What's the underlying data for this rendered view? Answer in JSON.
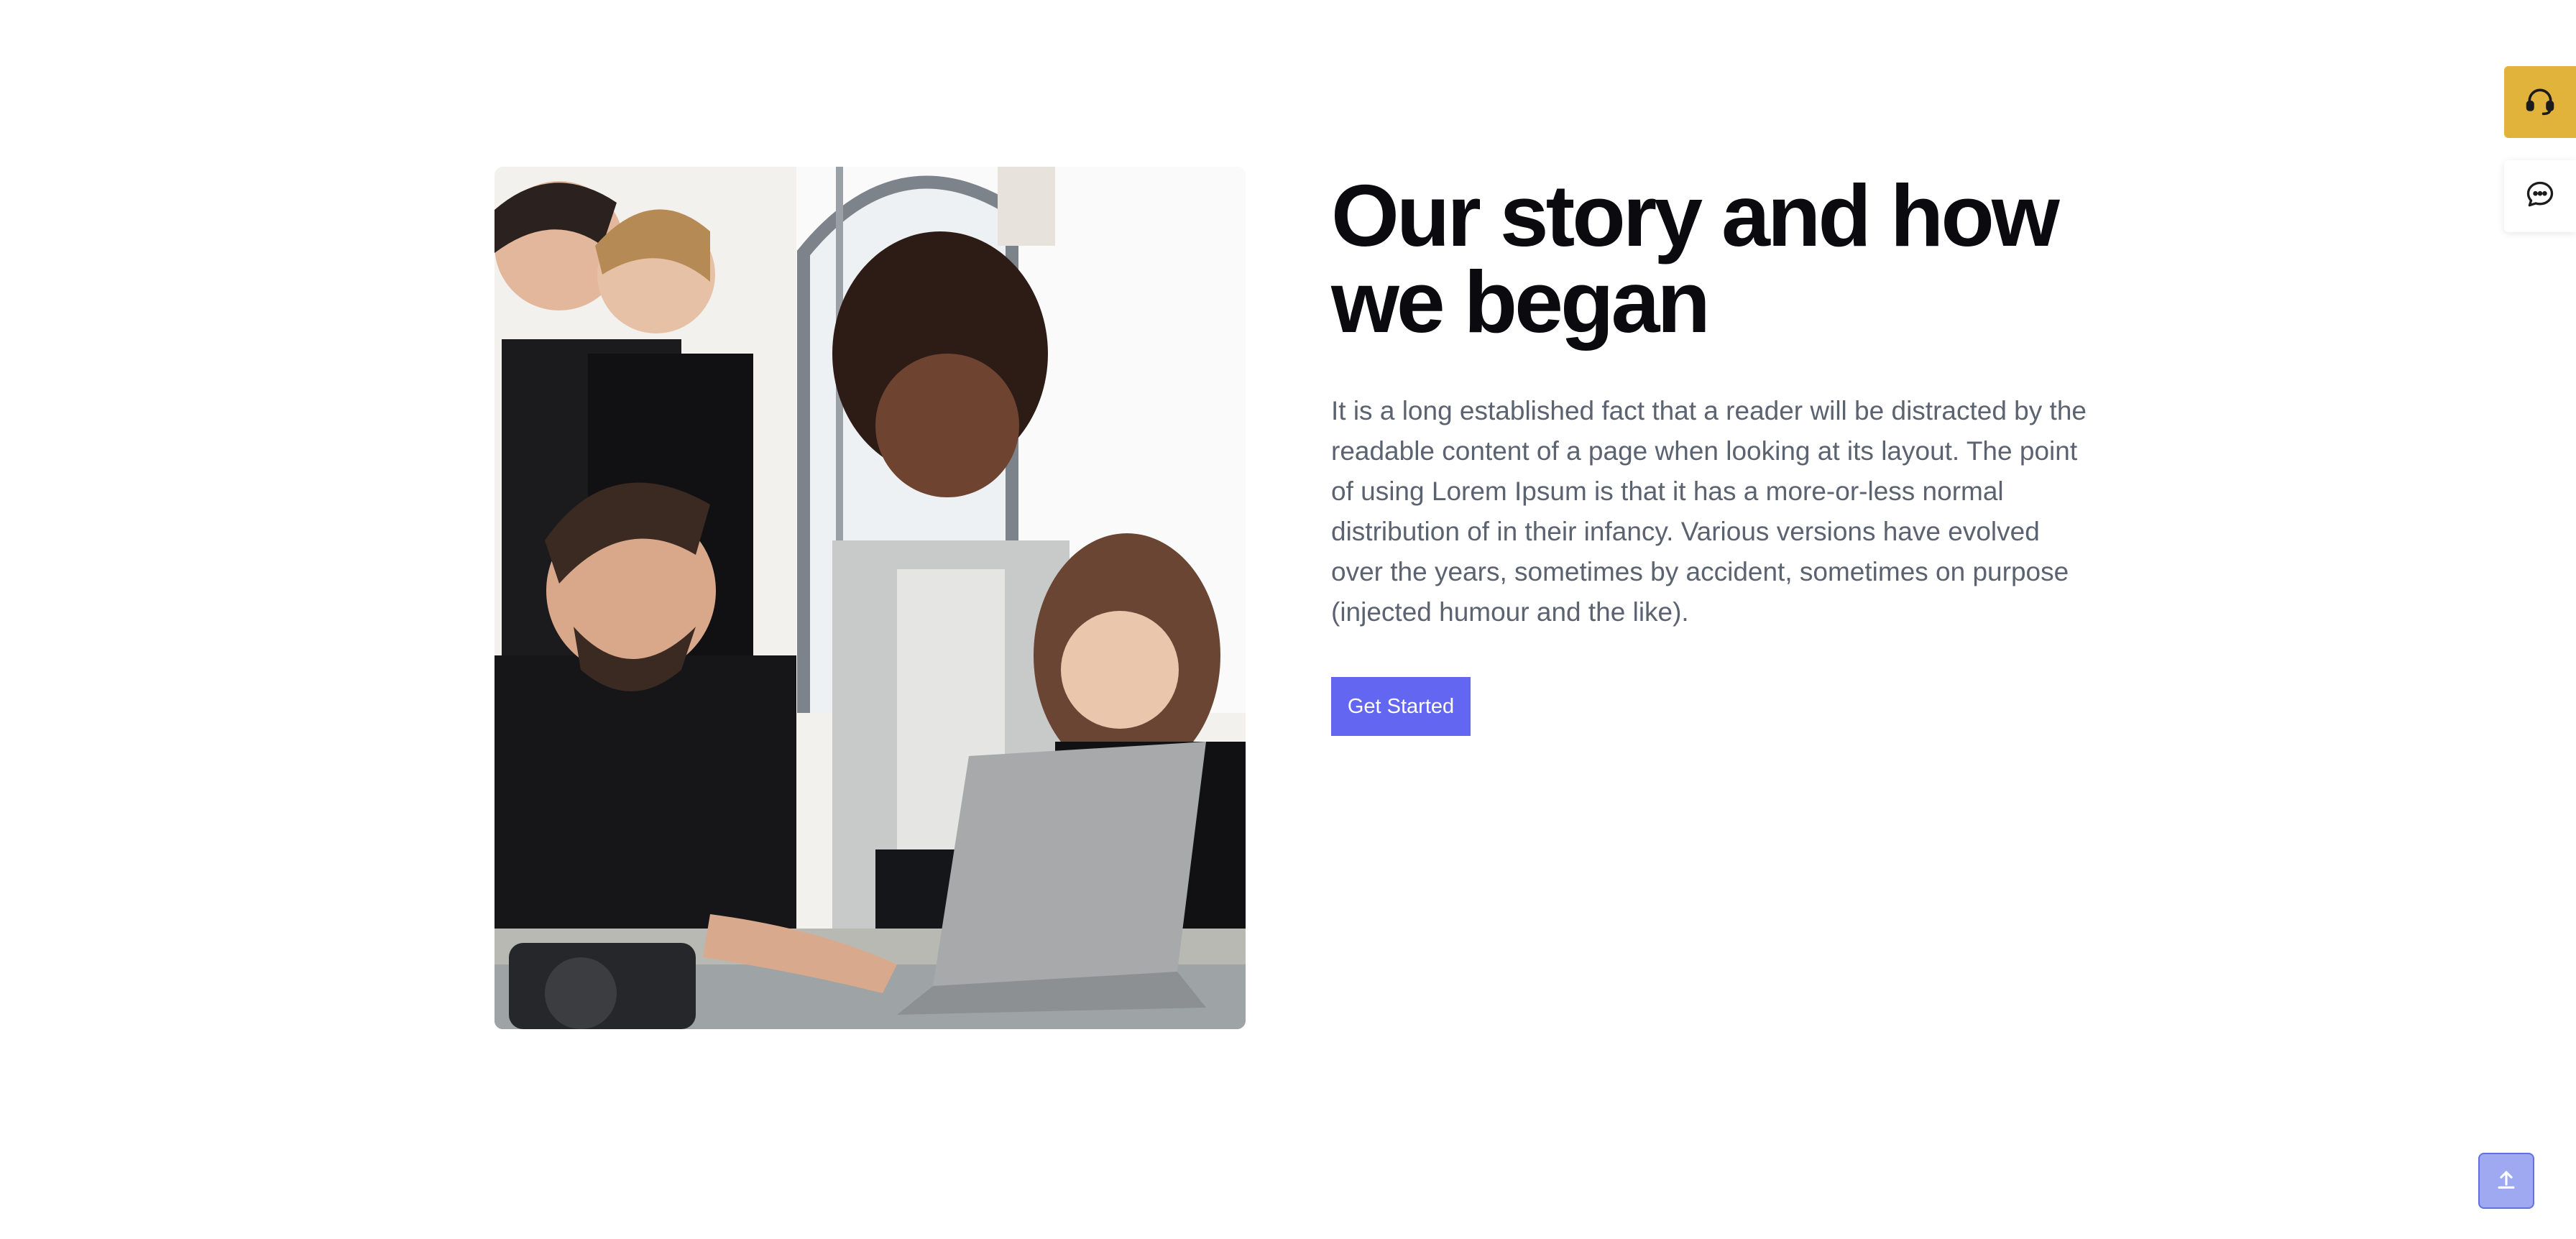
{
  "hero": {
    "headline": "Our story and how we began",
    "body": "It is a long established fact that a reader will be distracted by the readable content of a page when looking at its layout. The point of using Lorem Ipsum is that it has a more-or-less normal distribution of in their infancy. Various versions have evolved over the years, sometimes by accident, sometimes on purpose (injected humour and the like).",
    "cta_label": "Get Started"
  },
  "widgets": {
    "support_icon": "headset-icon",
    "chat_icon": "chat-bubble-icon",
    "back_to_top_icon": "arrow-up-icon"
  },
  "colors": {
    "accent": "#6366f1",
    "support_widget": "#e2b33b",
    "back_to_top": "#9ea9f2",
    "headline": "#0b0b0f",
    "body_text": "#5b6270"
  }
}
